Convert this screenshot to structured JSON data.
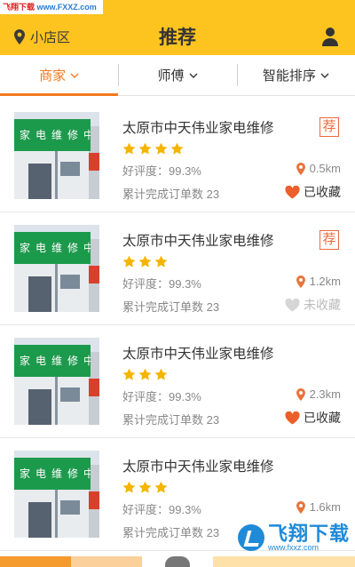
{
  "watermark": {
    "top_site": "飞翔下载",
    "top_url": "www.FXXZ.com",
    "bottom_name": "飞翔下载",
    "bottom_url": "www.fxxz.com"
  },
  "header": {
    "location": "小店区",
    "title": "推荐",
    "location_icon": "location-pin-icon",
    "user_icon": "user-icon"
  },
  "filters": [
    {
      "label": "商家",
      "active": true
    },
    {
      "label": "师傅",
      "active": false
    },
    {
      "label": "智能排序",
      "active": false
    }
  ],
  "shops": [
    {
      "name": "太原市中天伟业家电维修",
      "recommended": true,
      "badge": "荐",
      "stars": 4,
      "rating": "好评度：99.3%",
      "orders": "累计完成订单数 23",
      "distance": "0.5km",
      "favorited": true,
      "fav_label": "已收藏",
      "sign": "家电维修中"
    },
    {
      "name": "太原市中天伟业家电维修",
      "recommended": true,
      "badge": "荐",
      "stars": 3,
      "rating": "好评度：99.3%",
      "orders": "累计完成订单数 23",
      "distance": "1.2km",
      "favorited": false,
      "fav_label": "未收藏",
      "sign": "家电维修中"
    },
    {
      "name": "太原市中天伟业家电维修",
      "recommended": false,
      "badge": "",
      "stars": 3,
      "rating": "好评度：99.3%",
      "orders": "累计完成订单数 23",
      "distance": "2.3km",
      "favorited": true,
      "fav_label": "已收藏",
      "sign": "家电维修中"
    },
    {
      "name": "太原市中天伟业家电维修",
      "recommended": false,
      "badge": "",
      "stars": 3,
      "rating": "好评度：99.3%",
      "orders": "累计完成订单数 23",
      "distance": "1.6km",
      "favorited": false,
      "fav_label": "",
      "sign": "家电维修中"
    }
  ],
  "colors": {
    "header_bg": "#fdc41f",
    "accent": "#f37a1f",
    "star": "#f5b400",
    "pin": "#e8743a",
    "heart_on": "#ec5f2a",
    "heart_off": "#d6d6d6",
    "badge": "#ec6a3a"
  }
}
